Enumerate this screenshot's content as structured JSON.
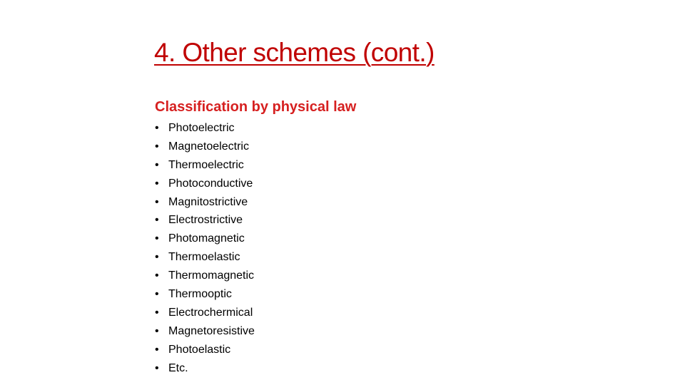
{
  "slide": {
    "title": "4. Other schemes (cont.)",
    "subtitle": "Classification by physical law",
    "bullet_glyph": "•",
    "items": [
      "Photoelectric",
      "Magnetoelectric",
      "Thermoelectric",
      "Photoconductive",
      "Magnitostrictive",
      "Electrostrictive",
      "Photomagnetic",
      "Thermoelastic",
      "Thermomagnetic",
      "Thermooptic",
      "Electrochermical",
      "Magnetoresistive",
      "Photoelastic",
      "Etc."
    ],
    "colors": {
      "title": "#C00000",
      "subtitle": "#D62020",
      "body_text": "#000000",
      "background": "#FFFFFF"
    }
  }
}
